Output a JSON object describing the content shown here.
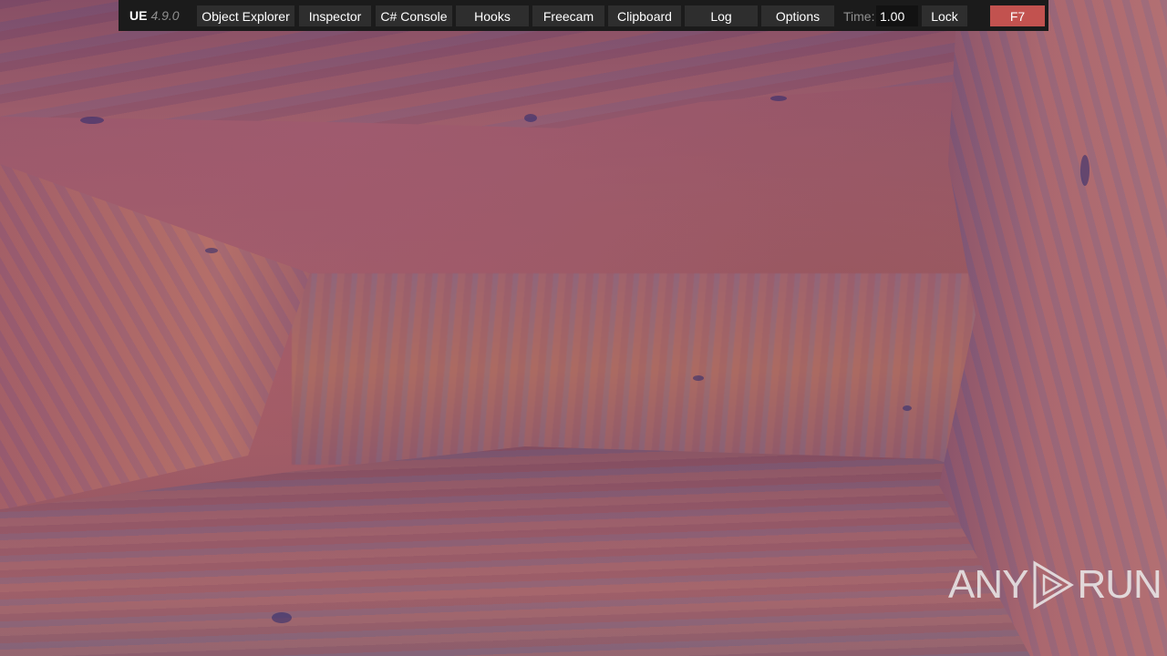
{
  "toolbar": {
    "logo": "UE",
    "version": "4.9.0",
    "tabs": [
      {
        "label": "Object Explorer"
      },
      {
        "label": "Inspector"
      },
      {
        "label": "C# Console"
      },
      {
        "label": "Hooks"
      },
      {
        "label": "Freecam"
      },
      {
        "label": "Clipboard"
      },
      {
        "label": "Log"
      },
      {
        "label": "Options"
      }
    ],
    "time_label": "Time:",
    "time_value": "1.00",
    "lock_label": "Lock",
    "close_label": "F7"
  },
  "watermark": {
    "left": "ANY",
    "right": "RUN"
  },
  "colors": {
    "bar_bg": "#1b1b1b",
    "tab_bg": "#2e2e2e",
    "accent_close": "#c2524f"
  },
  "icons": {
    "watermark_play": "play-triangle-icon"
  }
}
